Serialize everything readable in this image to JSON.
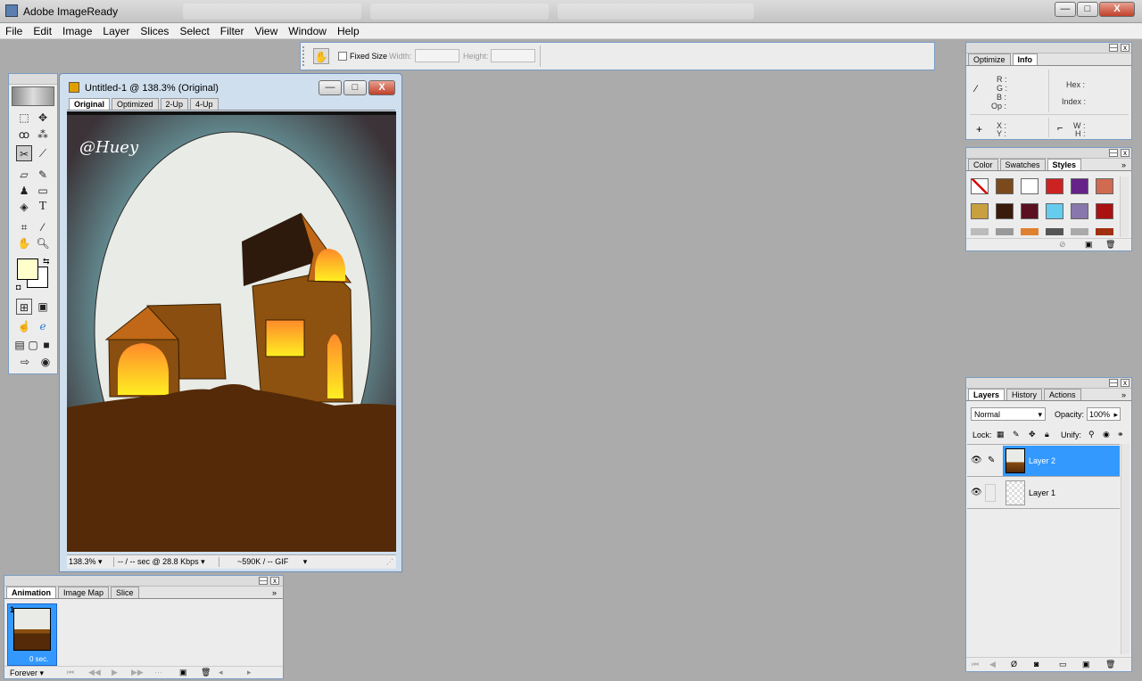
{
  "app": {
    "title": "Adobe ImageReady"
  },
  "window_buttons": {
    "minimize": "—",
    "maximize": "□",
    "close": "X"
  },
  "menu": [
    "File",
    "Edit",
    "Image",
    "Layer",
    "Slices",
    "Select",
    "Filter",
    "View",
    "Window",
    "Help"
  ],
  "options_bar": {
    "fixed_size": "Fixed Size",
    "width_label": "Width:",
    "height_label": "Height:",
    "width_value": "",
    "height_value": ""
  },
  "document": {
    "title": "Untitled-1 @ 138.3% (Original)",
    "tabs": [
      "Original",
      "Optimized",
      "2-Up",
      "4-Up"
    ],
    "active_tab": "Original",
    "zoom": "138.3%",
    "speed": "-- / -- sec @ 28.8 Kbps",
    "size": "~590K / -- GIF",
    "signature": "@Huey"
  },
  "info_panel": {
    "tabs": [
      "Optimize",
      "Info"
    ],
    "active": "Info",
    "r": "R :",
    "g": "G :",
    "b": "B :",
    "op": "Op :",
    "hex": "Hex :",
    "index": "Index :",
    "x": "X :",
    "y": "Y :",
    "w": "W :",
    "h": "H :"
  },
  "styles_panel": {
    "tabs": [
      "Color",
      "Swatches",
      "Styles"
    ],
    "active": "Styles",
    "swatches": [
      "#ffffff",
      "#7a4a1c",
      "#ffffff",
      "#cc2222",
      "#662288",
      "#d06a50",
      "#c8a040",
      "#3a1a0a",
      "#5a1020",
      "#66ccee",
      "#8877aa",
      "#aa1111"
    ]
  },
  "layers_panel": {
    "tabs": [
      "Layers",
      "History",
      "Actions"
    ],
    "active": "Layers",
    "blend": "Normal",
    "opacity_label": "Opacity:",
    "opacity": "100%",
    "lock": "Lock:",
    "unify": "Unify:",
    "layers": [
      {
        "name": "Layer 2",
        "selected": true
      },
      {
        "name": "Layer 1",
        "selected": false
      }
    ]
  },
  "animation_panel": {
    "tabs": [
      "Animation",
      "Image Map",
      "Slice"
    ],
    "active": "Animation",
    "frame_number": "1",
    "frame_delay": "0 sec.",
    "loop": "Forever"
  },
  "colors": {
    "accent": "#3399ff",
    "window_border": "#7a9cc4",
    "foreground": "#ffffcc",
    "background": "#ffffff"
  }
}
